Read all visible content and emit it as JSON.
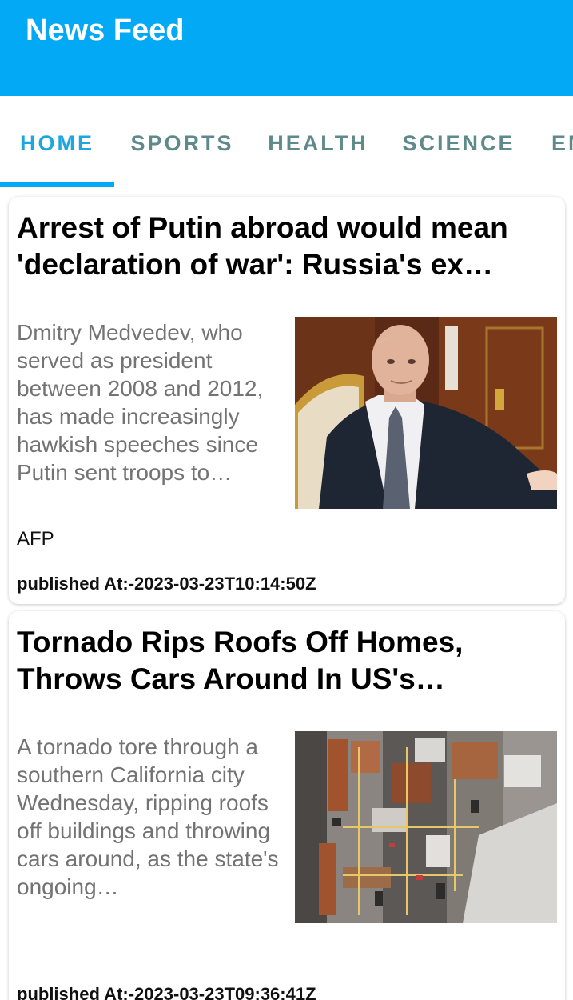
{
  "app": {
    "title": "News Feed"
  },
  "tabs": [
    "HOME",
    "SPORTS",
    "HEALTH",
    "SCIENCE",
    "EN"
  ],
  "articles": [
    {
      "headline": "Arrest of Putin abroad would mean 'declaration of war': Russia's ex…",
      "description": "Dmitry Medvedev, who served as president between 2008 and 2012, has made increasingly hawkish speeches since Putin sent troops to…",
      "source": "AFP",
      "published": "published At:-2023-03-23T10:14:50Z"
    },
    {
      "headline": "Tornado Rips Roofs Off Homes, Throws Cars Around In US's…",
      "description": "A tornado tore through a southern California city Wednesday, ripping roofs off buildings and throwing cars around, as the state's ongoing…",
      "source": "",
      "published": "published At:-2023-03-23T09:36:41Z"
    }
  ],
  "colors": {
    "appbar": "#03a9f4",
    "tab_active": "#1ea6de",
    "tab_inactive": "#5f8a8b"
  }
}
